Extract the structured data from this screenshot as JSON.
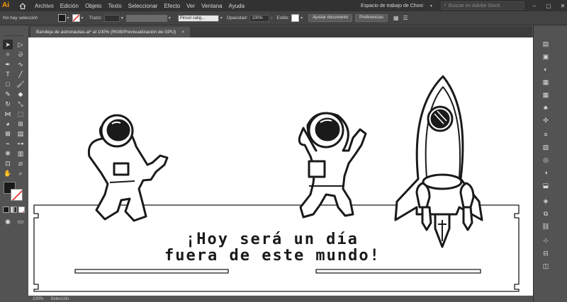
{
  "app": {
    "logo": "Ai",
    "menu": [
      "Archivo",
      "Edición",
      "Objeto",
      "Texto",
      "Seleccionar",
      "Efecto",
      "Ver",
      "Ventana",
      "Ayuda"
    ],
    "workspace": "Espacio de trabajo de Choni",
    "search_placeholder": "Buscar en Adobe Stock"
  },
  "controlbar": {
    "selection_status": "No hay selección",
    "stroke_label": "Trazo:",
    "brush_label": "Pincel calig...",
    "opacity_label": "Opacidad:",
    "opacity_value": "100%",
    "style_label": "Estilo:",
    "document_setup": "Ajustar documento",
    "preferences": "Preferencias"
  },
  "document": {
    "tab_title": "Bandeja de astronautas.ai* al 100% (RGB/Previsualización de GPU)",
    "tab_close": "×",
    "slogan_line1": "¡Hoy será un día",
    "slogan_line2": "fuera de este mundo!"
  },
  "statusbar": {
    "zoom": "100%",
    "tool": "Selección"
  },
  "colors": {
    "fill": "#1a1a1a",
    "stroke": "#ffffff",
    "logo": "#ff9a00",
    "panel": "#535353",
    "menubar": "#323232"
  },
  "icons": {
    "toolbar": [
      "selection-icon",
      "direct-selection-icon",
      "magic-wand-icon",
      "lasso-icon",
      "pen-icon",
      "curvature-icon",
      "type-icon",
      "line-icon",
      "rectangle-icon",
      "paintbrush-icon",
      "pencil-icon",
      "eraser-icon",
      "rotate-icon",
      "scale-icon",
      "width-icon",
      "free-transform-icon",
      "shape-builder-icon",
      "perspective-icon",
      "mesh-icon",
      "gradient-icon",
      "eyedropper-icon",
      "blend-icon",
      "symbol-sprayer-icon",
      "column-graph-icon",
      "artboard-icon",
      "slice-icon",
      "hand-icon",
      "zoom-icon"
    ],
    "rightpanel": [
      "properties-icon",
      "libraries-icon",
      "color-icon",
      "color-guide-icon",
      "swatches-icon",
      "brushes-icon",
      "symbols-icon",
      "stroke-icon",
      "gradient-panel-icon",
      "transparency-icon",
      "appearance-icon",
      "graphic-styles-icon",
      "layers-icon",
      "artboards-panel-icon",
      "links-icon",
      "transform-icon",
      "align-icon",
      "pathfinder-icon"
    ]
  }
}
